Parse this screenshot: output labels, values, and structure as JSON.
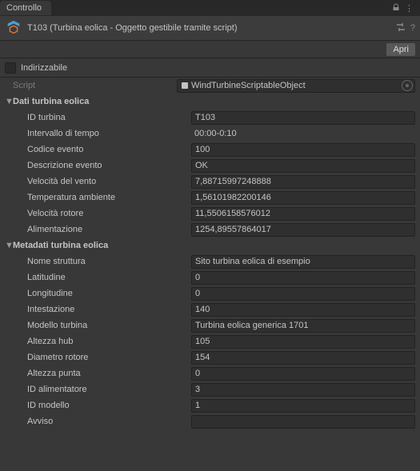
{
  "tab": {
    "title": "Controllo"
  },
  "header": {
    "title": "T103 (Turbina eolica - Oggetto gestibile tramite script)",
    "open_label": "Apri"
  },
  "addressable": {
    "label": "Indirizzabile"
  },
  "script_row": {
    "label": "Script",
    "value": "WindTurbineScriptableObject"
  },
  "section1": {
    "title": "Dati turbina eolica",
    "fields": {
      "turbine_id": {
        "label": "ID turbina",
        "value": "T103"
      },
      "time_interval": {
        "label": "Intervallo di tempo",
        "value": "00:00-0:10"
      },
      "event_code": {
        "label": "Codice evento",
        "value": "100"
      },
      "event_desc": {
        "label": "Descrizione evento",
        "value": "OK"
      },
      "wind_speed": {
        "label": "Velocità del vento",
        "value": "7,88715997248888"
      },
      "ambient_temp": {
        "label": "Temperatura ambiente",
        "value": "1,56101982200146"
      },
      "rotor_speed": {
        "label": "Velocità rotore",
        "value": "11,5506158576012"
      },
      "power": {
        "label": "Alimentazione",
        "value": "1254,89557864017"
      }
    }
  },
  "section2": {
    "title": "Metadati turbina eolica",
    "fields": {
      "site_name": {
        "label": "Nome struttura",
        "value": "Sito turbina eolica di esempio"
      },
      "latitude": {
        "label": "Latitudine",
        "value": "0"
      },
      "longitude": {
        "label": "Longitudine",
        "value": "0"
      },
      "heading": {
        "label": "Intestazione",
        "value": "140"
      },
      "model": {
        "label": "Modello turbina",
        "value": "Turbina eolica generica 1701"
      },
      "hub_height": {
        "label": "Altezza hub",
        "value": "105"
      },
      "rotor_dia": {
        "label": "Diametro rotore",
        "value": "154"
      },
      "tip_height": {
        "label": "Altezza punta",
        "value": "0"
      },
      "feeder_id": {
        "label": "ID alimentatore",
        "value": "3"
      },
      "model_id": {
        "label": "ID modello",
        "value": "1"
      },
      "warning": {
        "label": "Avviso",
        "value": ""
      }
    }
  }
}
